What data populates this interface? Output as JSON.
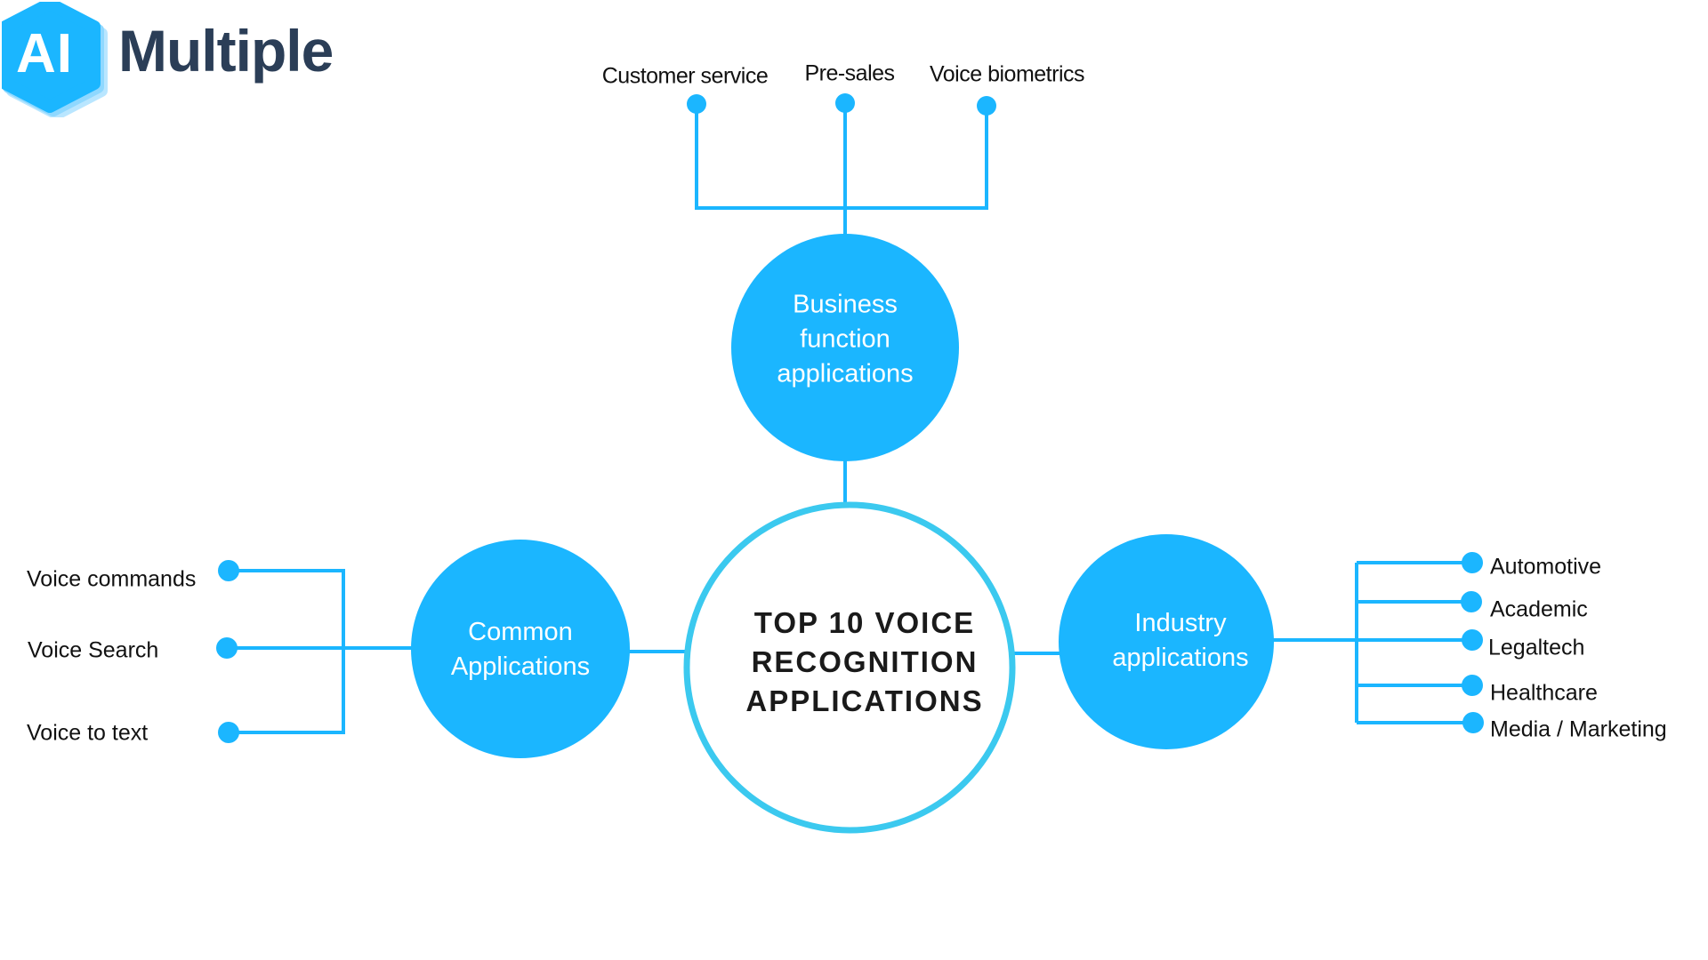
{
  "logo": {
    "badge": "AI",
    "wordmark": "Multiple",
    "colors": {
      "badge": "#1bb6ff",
      "badge_shadow": "#8fd8ff",
      "wordmark": "#2b3e57"
    }
  },
  "colors": {
    "node_fill": "#1bb6ff",
    "connector": "#1bb6ff",
    "center_ring": "#3bc9ef",
    "label_text": "#111111"
  },
  "center": {
    "lines": [
      "TOP 10 VOICE",
      "RECOGNITION",
      "APPLICATIONS"
    ]
  },
  "branches": {
    "business": {
      "title_lines": [
        "Business",
        "function",
        "applications"
      ],
      "items": [
        "Customer service",
        "Pre-sales",
        "Voice biometrics"
      ]
    },
    "common": {
      "title_lines": [
        "Common",
        "Applications"
      ],
      "items": [
        "Voice commands",
        "Voice Search",
        "Voice to text"
      ]
    },
    "industry": {
      "title_lines": [
        "Industry",
        "applications"
      ],
      "items": [
        "Automotive",
        "Academic",
        "Legaltech",
        "Healthcare",
        "Media / Marketing"
      ]
    }
  }
}
